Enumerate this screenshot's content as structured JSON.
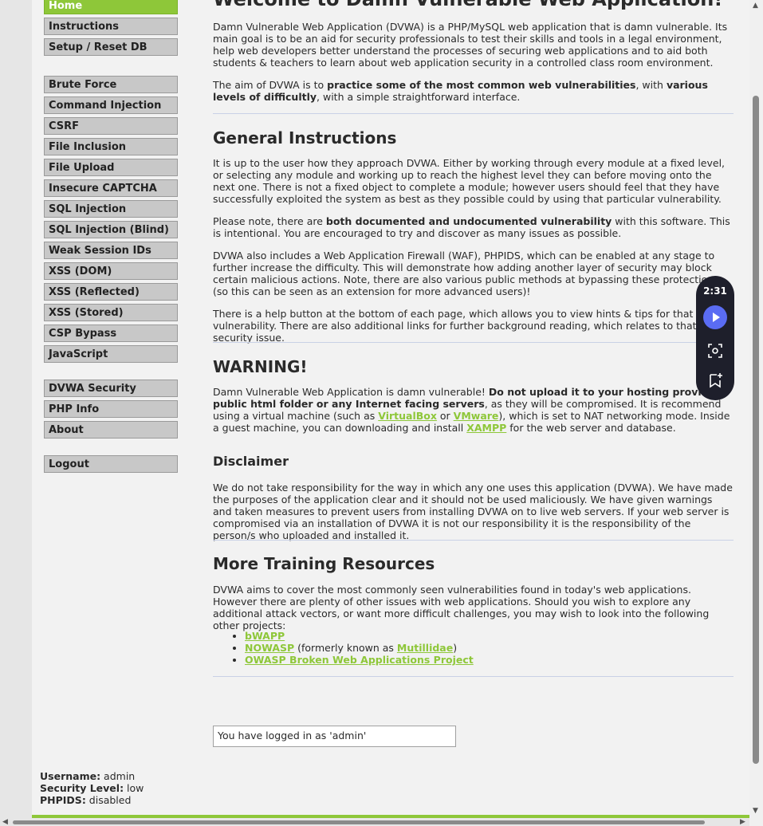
{
  "menu": {
    "block1": [
      "Home",
      "Instructions",
      "Setup / Reset DB"
    ],
    "block2": [
      "Brute Force",
      "Command Injection",
      "CSRF",
      "File Inclusion",
      "File Upload",
      "Insecure CAPTCHA",
      "SQL Injection",
      "SQL Injection (Blind)",
      "Weak Session IDs",
      "XSS (DOM)",
      "XSS (Reflected)",
      "XSS (Stored)",
      "CSP Bypass",
      "JavaScript"
    ],
    "block3": [
      "DVWA Security",
      "PHP Info",
      "About"
    ],
    "block4": [
      "Logout"
    ]
  },
  "main": {
    "title": "Welcome to Damn Vulnerable Web Application!",
    "intro1": "Damn Vulnerable Web Application (DVWA) is a PHP/MySQL web application that is damn vulnerable. Its main goal is to be an aid for security professionals to test their skills and tools in a legal environment, help web developers better understand the processes of securing web applications and to aid both students & teachers to learn about web application security in a controlled class room environment.",
    "intro2_a": "The aim of DVWA is to ",
    "intro2_b": "practice some of the most common web vulnerabilities",
    "intro2_c": ", with ",
    "intro2_d": "various levels of difficultly",
    "intro2_e": ", with a simple straightforward interface.",
    "gen_heading": "General Instructions",
    "gen_p1": "It is up to the user how they approach DVWA. Either by working through every module at a fixed level, or selecting any module and working up to reach the highest level they can before moving onto the next one. There is not a fixed object to complete a module; however users should feel that they have successfully exploited the system as best as they possible could by using that particular vulnerability.",
    "gen_p2_a": "Please note, there are ",
    "gen_p2_b": "both documented and undocumented vulnerability",
    "gen_p2_c": " with this software. This is intentional. You are encouraged to try and discover as many issues as possible.",
    "gen_p3": "DVWA also includes a Web Application Firewall (WAF), PHPIDS, which can be enabled at any stage to further increase the difficulty. This will demonstrate how adding another layer of security may block certain malicious actions. Note, there are also various public methods at bypassing these protections (so this can be seen as an extension for more advanced users)!",
    "gen_p4": "There is a help button at the bottom of each page, which allows you to view hints & tips for that vulnerability. There are also additional links for further background reading, which relates to that security issue.",
    "warn_heading": "WARNING!",
    "warn_a": "Damn Vulnerable Web Application is damn vulnerable! ",
    "warn_b": "Do not upload it to your hosting provider's public html folder or any Internet facing servers",
    "warn_c": ", as they will be compromised. It is recommend using a virtual machine (such as ",
    "warn_link1": "VirtualBox",
    "warn_d": " or ",
    "warn_link2": "VMware",
    "warn_e": "), which is set to NAT networking mode. Inside a guest machine, you can downloading and install ",
    "warn_link3": "XAMPP",
    "warn_f": " for the web server and database.",
    "disc_heading": "Disclaimer",
    "disc_p": "We do not take responsibility for the way in which any one uses this application (DVWA). We have made the purposes of the application clear and it should not be used maliciously. We have given warnings and taken measures to prevent users from installing DVWA on to live web servers. If your web server is compromised via an installation of DVWA it is not our responsibility it is the responsibility of the person/s who uploaded and installed it.",
    "more_heading": "More Training Resources",
    "more_p": "DVWA aims to cover the most commonly seen vulnerabilities found in today's web applications. However there are plenty of other issues with web applications. Should you wish to explore any additional attack vectors, or want more difficult challenges, you may wish to look into the following other projects:",
    "res1": "bWAPP",
    "res2": "NOWASP",
    "res2_mid": " (formerly known as ",
    "res2_link": "Mutillidae",
    "res2_end": ")",
    "res3": "OWASP Broken Web Applications Project"
  },
  "logged_msg": "You have logged in as 'admin'",
  "userinfo": {
    "username_label": "Username:",
    "username": " admin",
    "security_label": "Security Level:",
    "security": " low",
    "phpids_label": "PHPIDS:",
    "phpids": " disabled"
  },
  "widget": {
    "time": "2:31"
  },
  "colors": {
    "accent": "#8ec739",
    "play": "#5a6cf3"
  }
}
